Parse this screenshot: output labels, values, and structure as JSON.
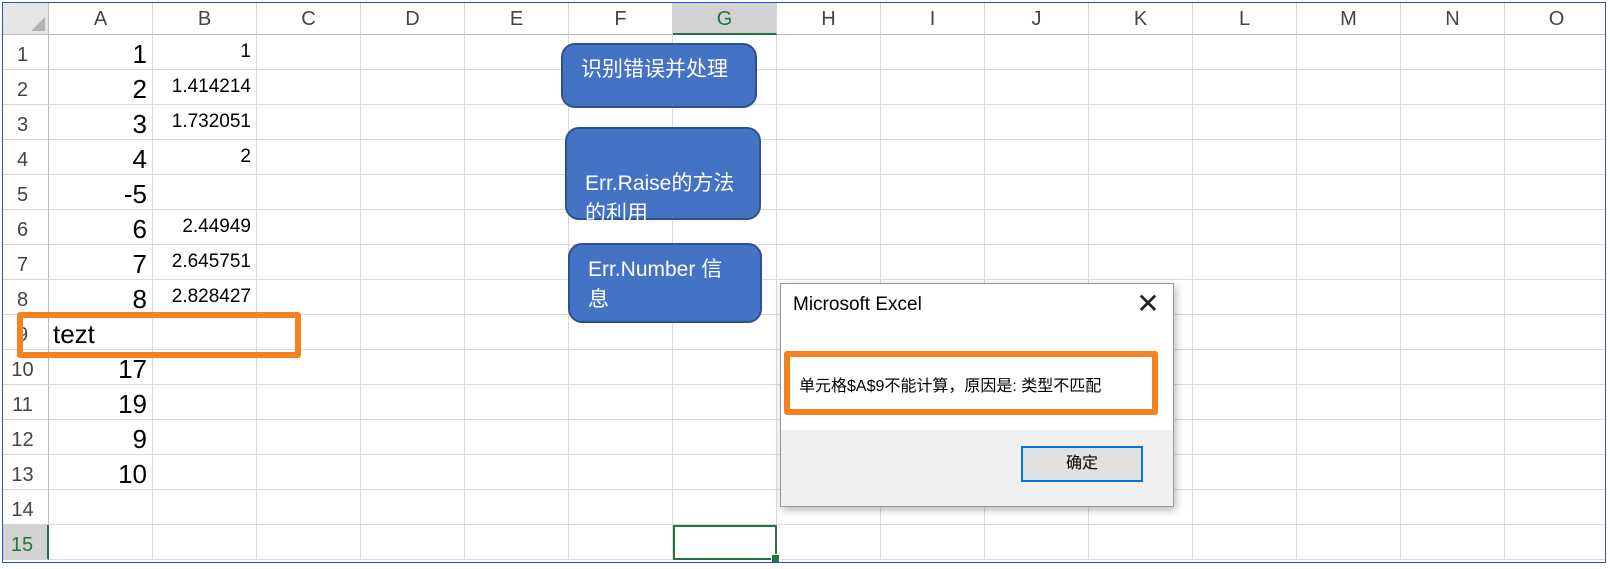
{
  "columns": [
    "A",
    "B",
    "C",
    "D",
    "E",
    "F",
    "G",
    "H",
    "I",
    "J",
    "K",
    "L",
    "M",
    "N",
    "O"
  ],
  "active_column": "G",
  "rows": [
    "1",
    "2",
    "3",
    "4",
    "5",
    "6",
    "7",
    "8",
    "9",
    "10",
    "11",
    "12",
    "13",
    "14",
    "15"
  ],
  "active_row": "15",
  "cells": {
    "A": [
      "1",
      "2",
      "3",
      "4",
      "-5",
      "6",
      "7",
      "8",
      "tezt",
      "17",
      "19",
      "9",
      "10"
    ],
    "B": [
      "1",
      "1.414214",
      "1.732051",
      "2",
      "",
      "2.44949",
      "2.645751",
      "2.828427"
    ]
  },
  "selected_cell": "G15",
  "shapes": [
    {
      "label": "识别错误并处理"
    },
    {
      "label": "Err.Raise的方法\n的利用"
    },
    {
      "label": "Err.Number 信息"
    }
  ],
  "dialog": {
    "title": "Microsoft Excel",
    "close_glyph": "✕",
    "message": "单元格$A$9不能计算，原因是: 类型不匹配",
    "ok_label": "确定"
  },
  "highlight_color": "#f58220",
  "shape_fill_color": "#4472c4",
  "selection_color": "#217346"
}
